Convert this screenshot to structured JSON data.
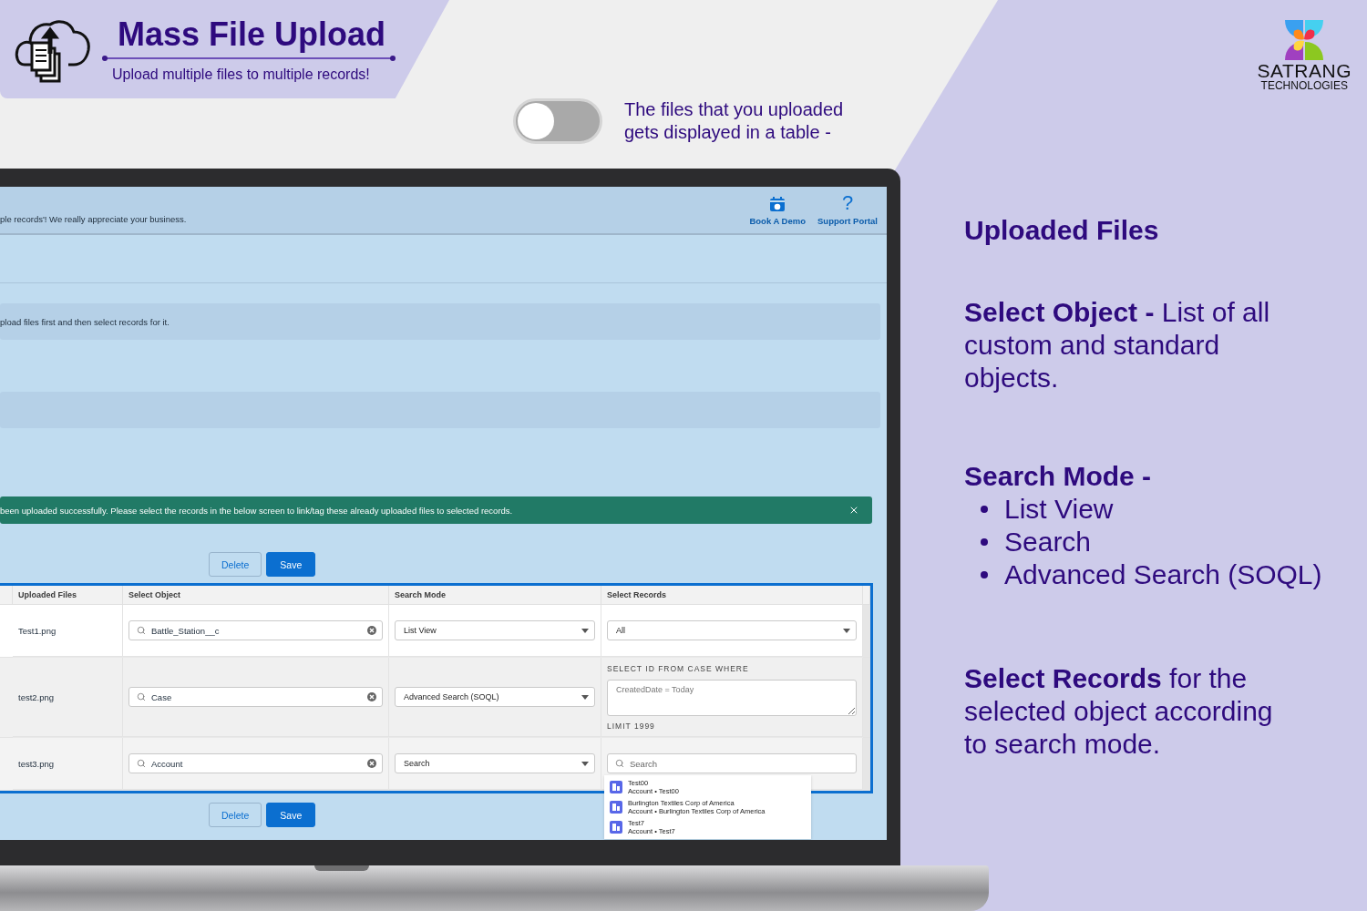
{
  "banner": {
    "title": "Mass File Upload",
    "subtitle": "Upload multiple files to multiple records!"
  },
  "toggle": {
    "on": false,
    "caption": "The files that you uploaded gets displayed in a table -"
  },
  "logo": {
    "name": "SATRANG",
    "tagline": "TECHNOLOGIES"
  },
  "app": {
    "header": {
      "message": "ple records'! We really appreciate your business.",
      "actions": [
        {
          "label": "Book A Demo",
          "kind": "calendar"
        },
        {
          "label": "Support Portal",
          "kind": "glyph",
          "glyph": "?"
        }
      ]
    },
    "info": "pload files first and then select records for it.",
    "toast": {
      "message": "been uploaded successfully. Please select the records in the below screen to link/tag these already uploaded files to selected records."
    },
    "buttons_top": [
      {
        "label": "Delete",
        "kind": "neutral"
      },
      {
        "label": "Save",
        "kind": "brand"
      }
    ],
    "table": {
      "columns": [
        "Uploaded Files",
        "Select Object",
        "Search Mode",
        "Select Records"
      ],
      "rows": [
        {
          "file": "Test1.png",
          "object": "Battle_Station__c",
          "mode": "List View",
          "records": {
            "kind": "picklist",
            "value": "All"
          }
        },
        {
          "file": "test2.png",
          "object": "Case",
          "mode": "Advanced Search (SOQL)",
          "records": {
            "kind": "soql",
            "prefix": "SELECT ID FROM CASE WHERE",
            "placeholder": "CreatedDate = Today",
            "suffix": "LIMIT 1999"
          }
        },
        {
          "file": "test3.png",
          "object": "Account",
          "mode": "Search",
          "records": {
            "kind": "lookup",
            "placeholder": "Search",
            "results": [
              {
                "title": "Test00",
                "subtitle": "Account • Test00"
              },
              {
                "title": "Burlington Textiles Corp of America",
                "subtitle": "Account • Burlington Textiles Corp of America"
              },
              {
                "title": "Test7",
                "subtitle": "Account • Test7"
              }
            ]
          }
        }
      ]
    },
    "buttons_bottom": [
      {
        "label": "Delete",
        "kind": "neutral"
      },
      {
        "label": "Save",
        "kind": "brand"
      }
    ]
  },
  "panel": {
    "sections": [
      {
        "kind": "heading",
        "text": "Uploaded Files"
      },
      {
        "kind": "paragraph",
        "text": "**Select Object -** List of all custom and standard objects."
      },
      {
        "kind": "list",
        "title": "Search Mode -",
        "items": [
          "List View",
          "Search",
          "Advanced Search (SOQL)"
        ]
      },
      {
        "kind": "paragraph",
        "text": "**Select Records** for the selected object according to search mode."
      }
    ]
  }
}
